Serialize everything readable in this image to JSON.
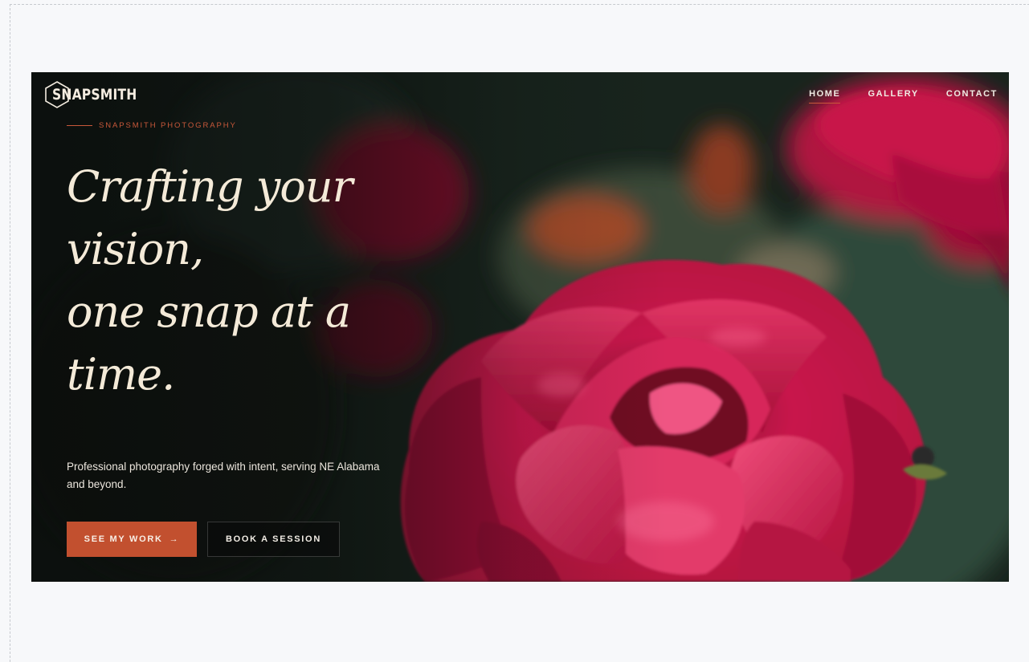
{
  "brand": {
    "name": "SNAPSMITH",
    "logo_icon": "hexagon-s-logo-icon"
  },
  "nav": {
    "items": [
      {
        "label": "HOME",
        "active": true
      },
      {
        "label": "GALLERY",
        "active": false
      },
      {
        "label": "CONTACT",
        "active": false
      }
    ]
  },
  "hero": {
    "eyebrow": "SNAPSMITH PHOTOGRAPHY",
    "headline_lines": [
      "Crafting your",
      "vision,",
      "one snap at a",
      "time."
    ],
    "tagline": "Professional photography forged with intent, serving NE Alabama and beyond.",
    "primary_button": {
      "label": "SEE MY WORK",
      "arrow": "→"
    },
    "secondary_button": {
      "label": "BOOK A SESSION"
    },
    "background_image": "red-rose-photo"
  },
  "colors": {
    "accent": "#c2502f",
    "headline": "#f4ead8",
    "page_background": "#f7f8fa"
  }
}
